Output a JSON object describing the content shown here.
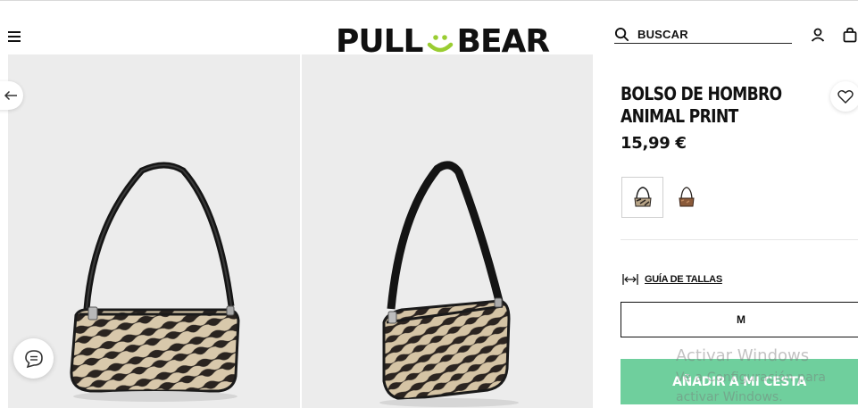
{
  "header": {
    "brand_left": "PULL",
    "brand_right": "BEAR",
    "search_label": "BUSCAR"
  },
  "product": {
    "title": "BOLSO DE HOMBRO ANIMAL PRINT",
    "price": "15,99 €",
    "size_guide_label": "GUÍA DE TALLAS",
    "size": "M",
    "add_to_cart_label": "AÑADIR A MI CESTA",
    "colors": [
      "zebra",
      "brown"
    ]
  },
  "watermark": {
    "line1": "Activar Windows",
    "line2": "Ve a Configuración para activar Windows."
  },
  "colors": {
    "accent_green": "#6fcf9d",
    "logo_smile": "#9acd32",
    "photo_bg": "#ececec"
  },
  "icons": [
    "menu-icon",
    "search-icon",
    "user-icon",
    "bag-icon",
    "arrow-left-icon",
    "chat-icon",
    "heart-icon",
    "size-guide-icon"
  ]
}
